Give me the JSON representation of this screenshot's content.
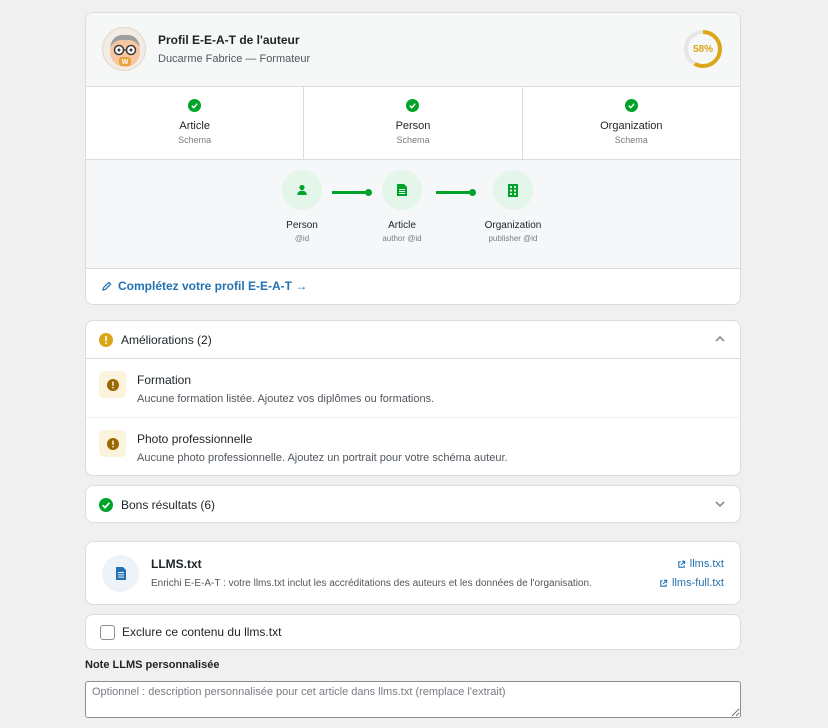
{
  "eat": {
    "title": "Profil E-E-A-T de l'auteur",
    "subtitle": "Ducarme Fabrice — Formateur",
    "score": 58,
    "score_text": "58%",
    "score_color": "#dba617",
    "avatar_icon": "avatar-icon"
  },
  "schemas": [
    {
      "name": "Article",
      "type": "Schema",
      "status_icon": "check-circle-icon"
    },
    {
      "name": "Person",
      "type": "Schema",
      "status_icon": "check-circle-icon"
    },
    {
      "name": "Organization",
      "type": "Schema",
      "status_icon": "check-circle-icon"
    }
  ],
  "graph": {
    "nodes": [
      {
        "label": "Person",
        "sub": "@id",
        "icon": "person-icon"
      },
      {
        "label": "Article",
        "sub": "author @id",
        "icon": "document-icon"
      },
      {
        "label": "Organization",
        "sub": "publisher @id",
        "icon": "building-icon"
      }
    ],
    "color": "#00a32a"
  },
  "complete_link": "Complétez votre profil E-E-A-T →",
  "improvements": {
    "title": "Améliorations (2)",
    "items": [
      {
        "title": "Formation",
        "desc": "Aucune formation listée. Ajoutez vos diplômes ou formations."
      },
      {
        "title": "Photo professionnelle",
        "desc": "Aucune photo professionnelle. Ajoutez un portrait pour votre schéma auteur."
      }
    ]
  },
  "good_results": {
    "title": "Bons résultats (6)"
  },
  "llms": {
    "title": "LLMS.txt",
    "desc": "Enrichi E-E-A-T : votre llms.txt inclut les accréditations des auteurs et les données de l'organisation.",
    "link1": "llms.txt",
    "link2": "llms-full.txt"
  },
  "exclude": {
    "label": "Exclure ce contenu du llms.txt",
    "checked": false
  },
  "note": {
    "label": "Note LLMS personnalisée",
    "placeholder": "Optionnel : description personnalisée pour cet article dans llms.txt (remplace l'extrait)"
  },
  "colors": {
    "accent": "#2271b1",
    "success": "#00a32a",
    "warning": "#dba617"
  }
}
